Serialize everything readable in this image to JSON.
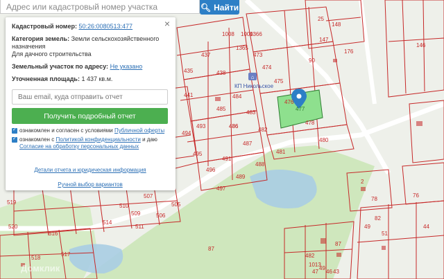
{
  "search": {
    "placeholder": "Адрес или кадастровый номер участка",
    "button_label": "Найти"
  },
  "popup": {
    "cadastral_label": "Кадастровый номер:",
    "cadastral_value": "50:26:0080513:477",
    "category_label": "Категория земель:",
    "category_value": "Земли сельскохозяйственного назначения",
    "usage_value": "Для дачного строительства",
    "address_label": "Земельный участок по адресу:",
    "address_value": "Не указано",
    "area_label": "Уточненная площадь:",
    "area_value": "1 437 кв.м.",
    "email_placeholder": "Ваш email, куда отправить отчет",
    "report_button": "Получить подробный отчет",
    "consent1_text": "ознакомлен и согласен с условиями",
    "consent1_link": "Публичной оферты",
    "consent2_text": "ознакомлен с",
    "consent2_link": "Политикой конфиденциальности",
    "consent2_mid": "и даю",
    "consent2_link2": "Согласие на обработку персональных данных",
    "details_link": "Детали отчета и юридическая информация",
    "manual_link": "Ручной выбор вариантов"
  },
  "map": {
    "poi_label": "КП Никольское",
    "selected_parcel": "477",
    "watermark": "Домклик",
    "parcel_labels": [
      "476",
      "90",
      "486",
      "1008",
      "1009",
      "1366",
      "437",
      "1365",
      "473",
      "474",
      "475",
      "478",
      "438",
      "435",
      "441",
      "485",
      "484",
      "483",
      "482",
      "486",
      "487",
      "481",
      "480",
      "488",
      "489",
      "497",
      "494",
      "495",
      "496",
      "491",
      "493",
      "499",
      "505",
      "507",
      "509",
      "510",
      "514",
      "511",
      "506",
      "516",
      "517",
      "518",
      "519",
      "520",
      "87",
      "25",
      "148",
      "147",
      "146",
      "176",
      "2",
      "82",
      "87",
      "49",
      "51",
      "76",
      "78",
      "482",
      "1013",
      "47",
      "49",
      "46",
      "43",
      "44",
      "40",
      "50"
    ],
    "colors": {
      "parcel_line": "#c62828",
      "selected_fill": "#8ee08e",
      "forest": "#cfe7bd",
      "water": "#a9cde3",
      "road": "#ffffff"
    }
  }
}
